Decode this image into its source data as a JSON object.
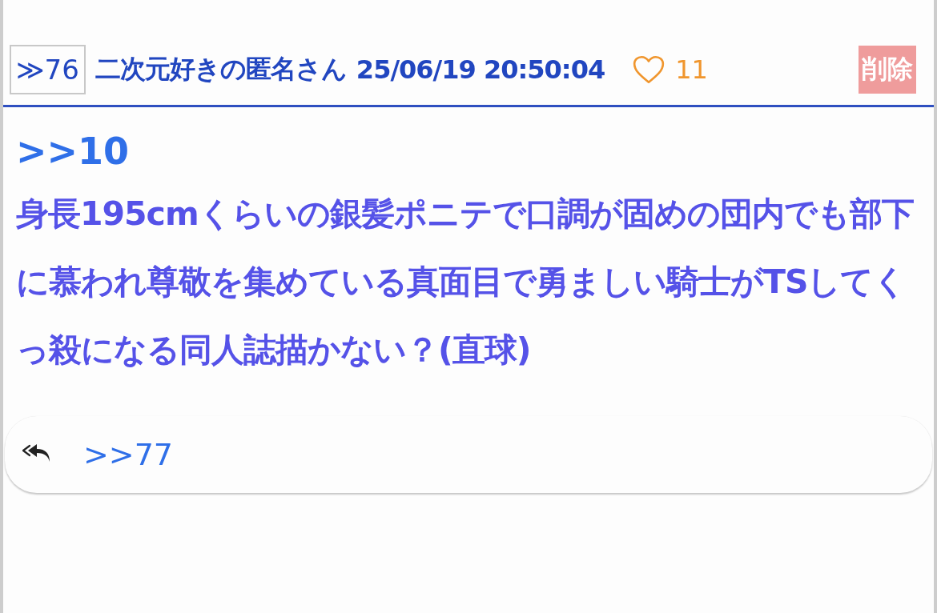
{
  "post": {
    "number": "≫76",
    "author": "二次元好きの匿名さん",
    "timestamp": "25/06/19 20:50:04",
    "likes": "11",
    "delete_label": "削除",
    "anchor": ">>10",
    "body": "身長195cmくらいの銀髪ポニテで口調が固めの団内でも部下に慕われ尊敬を集めている真面目で勇ましい騎士がTSしてくっ殺になる同人誌描かない？(直球)",
    "replies": [
      ">>77"
    ]
  }
}
